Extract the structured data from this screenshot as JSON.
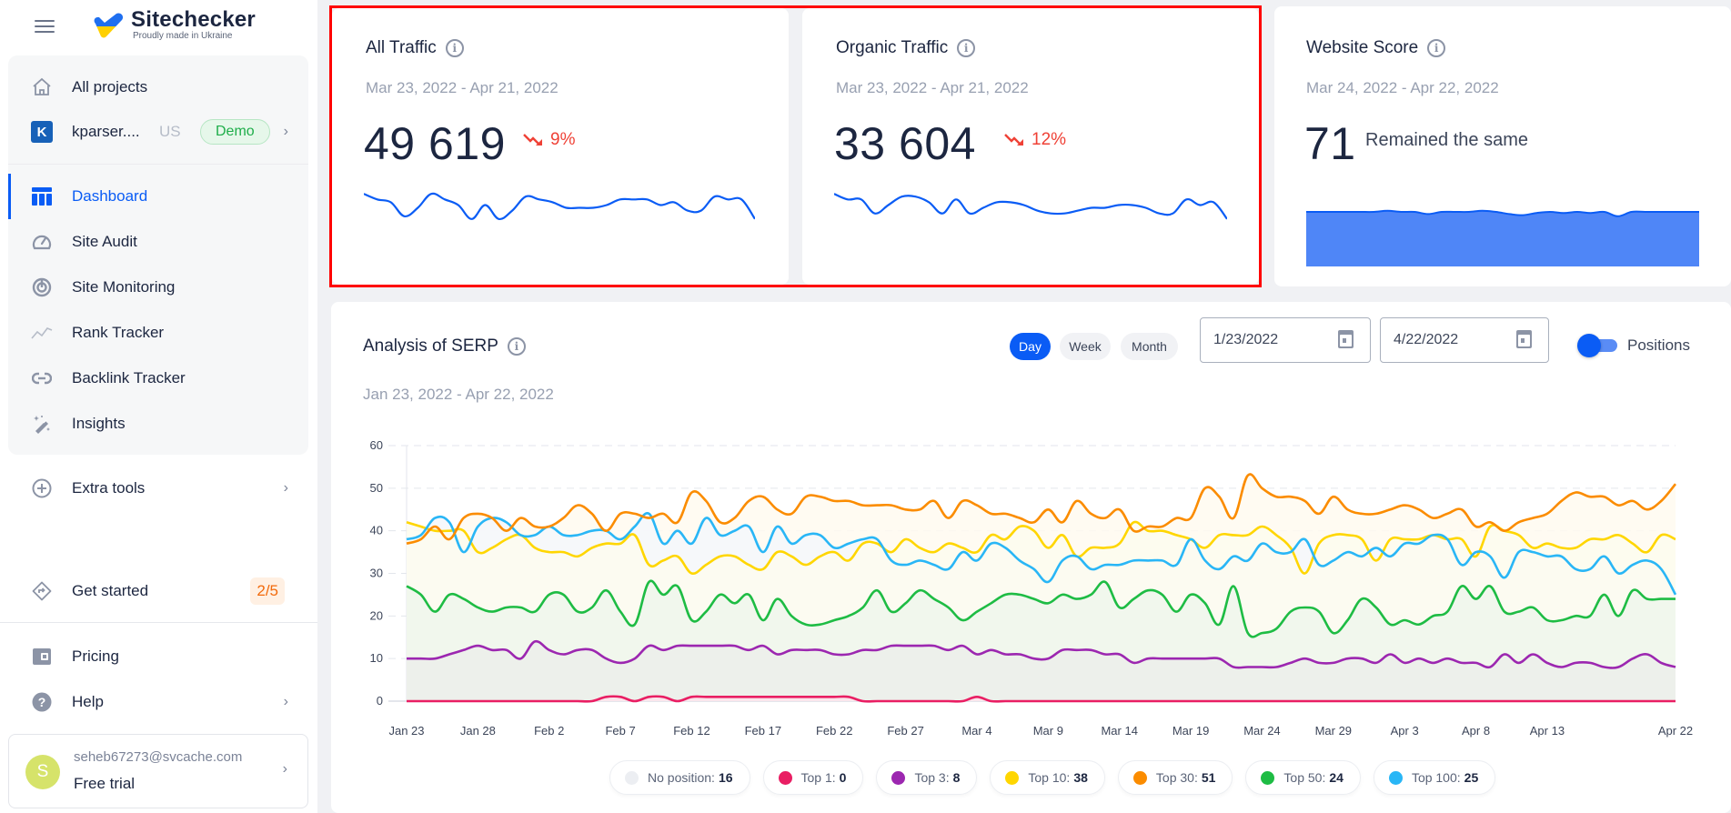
{
  "app": {
    "name": "Sitechecker",
    "tagline": "Proudly made in Ukraine"
  },
  "sidebar": {
    "all_projects": "All projects",
    "project": {
      "initial": "K",
      "name": "kparser....",
      "country": "US",
      "badge": "Demo"
    },
    "nav": [
      {
        "label": "Dashboard",
        "icon": "dashboard-icon",
        "active": true
      },
      {
        "label": "Site Audit",
        "icon": "speedometer-icon",
        "active": false
      },
      {
        "label": "Site Monitoring",
        "icon": "radar-icon",
        "active": false
      },
      {
        "label": "Rank Tracker",
        "icon": "trend-line-icon",
        "active": false
      },
      {
        "label": "Backlink Tracker",
        "icon": "link-icon",
        "active": false
      },
      {
        "label": "Insights",
        "icon": "magic-wand-icon",
        "active": false
      }
    ],
    "extra_tools": "Extra tools",
    "get_started": {
      "label": "Get started",
      "progress": "2/5"
    },
    "pricing": "Pricing",
    "help": "Help",
    "user": {
      "initial": "S",
      "email": "seheb67273@svcache.com",
      "plan": "Free trial"
    }
  },
  "cards": {
    "all_traffic": {
      "title": "All Traffic",
      "date_range": "Mar 23, 2022 - Apr 21, 2022",
      "value": "49 619",
      "delta": "9%",
      "trend": "down",
      "sparkline": [
        55,
        53,
        52,
        47,
        50,
        55,
        53,
        51,
        46,
        51,
        46,
        49,
        54,
        53,
        52,
        50,
        50,
        50,
        51,
        53,
        53,
        53,
        51,
        52,
        49,
        49,
        54,
        53,
        53,
        46
      ]
    },
    "organic_traffic": {
      "title": "Organic Traffic",
      "date_range": "Mar 23, 2022 - Apr 21, 2022",
      "value": "33 604",
      "delta": "12%",
      "trend": "down",
      "sparkline": [
        55,
        53,
        53,
        48,
        51,
        54,
        54,
        52,
        48,
        53,
        48,
        50,
        52,
        52,
        51,
        49,
        48,
        48,
        49,
        50,
        50,
        51,
        51,
        50,
        48,
        48,
        53,
        51,
        52,
        46
      ]
    },
    "website_score": {
      "title": "Website Score",
      "date_range": "Mar 24, 2022 - Apr 22, 2022",
      "value": "71",
      "status": "Remained the same",
      "area": [
        71,
        71,
        71,
        71,
        71,
        71,
        71.2,
        71,
        71,
        70.6,
        71,
        71,
        71,
        71.2,
        71,
        70.6,
        70.4,
        70.8,
        71,
        70.8,
        71,
        70.8,
        71,
        70.2,
        71,
        71,
        71,
        71,
        71,
        71
      ]
    }
  },
  "serp": {
    "title": "Analysis of SERP",
    "date_range": "Jan 23, 2022 - Apr 22, 2022",
    "granularity": [
      "Day",
      "Week",
      "Month"
    ],
    "active_granularity": "Day",
    "date_from": "1/23/2022",
    "date_to": "4/22/2022",
    "toggle_label": "Positions",
    "toggle_on": true
  },
  "chart_data": {
    "type": "area",
    "title": "Analysis of SERP",
    "xlabel": "",
    "ylabel": "",
    "ylim": [
      0,
      60
    ],
    "yticks": [
      0,
      10,
      20,
      30,
      40,
      50,
      60
    ],
    "grid": true,
    "legend_position": "bottom",
    "x_start": "Jan 23",
    "x_count": 90,
    "xtick_labels": [
      {
        "day": 0,
        "label": "Jan 23"
      },
      {
        "day": 5,
        "label": "Jan 28"
      },
      {
        "day": 10,
        "label": "Feb 2"
      },
      {
        "day": 15,
        "label": "Feb 7"
      },
      {
        "day": 20,
        "label": "Feb 12"
      },
      {
        "day": 25,
        "label": "Feb 17"
      },
      {
        "day": 30,
        "label": "Feb 22"
      },
      {
        "day": 35,
        "label": "Feb 27"
      },
      {
        "day": 40,
        "label": "Mar 4"
      },
      {
        "day": 45,
        "label": "Mar 9"
      },
      {
        "day": 50,
        "label": "Mar 14"
      },
      {
        "day": 55,
        "label": "Mar 19"
      },
      {
        "day": 60,
        "label": "Mar 24"
      },
      {
        "day": 65,
        "label": "Mar 29"
      },
      {
        "day": 70,
        "label": "Apr 3"
      },
      {
        "day": 75,
        "label": "Apr 8"
      },
      {
        "day": 80,
        "label": "Apr 13"
      },
      {
        "day": 89,
        "label": "Apr 22"
      }
    ],
    "series": [
      {
        "name": "No position",
        "key": "no_position",
        "color": "#eceef2",
        "current": 16,
        "values": null
      },
      {
        "name": "Top 1",
        "key": "top1",
        "color": "#e91e63",
        "current": 0,
        "values": [
          0,
          0,
          0,
          0,
          0,
          0,
          0,
          0,
          0,
          0,
          0,
          0,
          0,
          0,
          1,
          1,
          0,
          1,
          1,
          0,
          1,
          1,
          1,
          1,
          1,
          1,
          1,
          1,
          1,
          1,
          1,
          1,
          0,
          0,
          0,
          0,
          0,
          0,
          0,
          0,
          1,
          0,
          0,
          0,
          0,
          0,
          0,
          0,
          0,
          0,
          0,
          0,
          0,
          0,
          0,
          0,
          0,
          0,
          0,
          0,
          0,
          0,
          0,
          0,
          0,
          0,
          0,
          0,
          0,
          0,
          0,
          0,
          0,
          0,
          0,
          0,
          0,
          0,
          0,
          0,
          0,
          0,
          0,
          0,
          0,
          0,
          0,
          0,
          0,
          0
        ]
      },
      {
        "name": "Top 3",
        "key": "top3",
        "color": "#9c27b0",
        "current": 8,
        "values": [
          10,
          10,
          10,
          11,
          12,
          13,
          12,
          12,
          10,
          14,
          12,
          11,
          12,
          12,
          10,
          9,
          10,
          13,
          12,
          13,
          13,
          13,
          13,
          13,
          12,
          13,
          11,
          12,
          12,
          12,
          11,
          11,
          12,
          12,
          13,
          13,
          13,
          13,
          12,
          13,
          11,
          12,
          11,
          11,
          10,
          10,
          12,
          12,
          12,
          11,
          11,
          9,
          10,
          10,
          10,
          10,
          10,
          10,
          8,
          8,
          8,
          8,
          9,
          10,
          9,
          9,
          10,
          10,
          9,
          11,
          9,
          10,
          9,
          10,
          9,
          9,
          8,
          11,
          9,
          11,
          9,
          8,
          9,
          9,
          8,
          8,
          10,
          11,
          9,
          8
        ]
      },
      {
        "name": "Top 10",
        "key": "top10",
        "color": "#ffd600",
        "current": 38,
        "values": [
          42,
          41,
          40,
          40,
          40,
          35,
          36,
          38,
          39,
          36,
          35,
          35,
          34,
          36,
          37,
          37,
          39,
          32,
          33,
          34,
          30,
          32,
          34,
          34,
          32,
          31,
          35,
          34,
          32,
          34,
          35,
          33,
          37,
          37,
          35,
          38,
          36,
          35,
          37,
          36,
          35,
          39,
          38,
          41,
          40,
          36,
          39,
          34,
          36,
          36,
          37,
          42,
          40,
          40,
          39,
          38,
          36,
          39,
          39,
          39,
          41,
          39,
          36,
          30,
          37,
          39,
          39,
          38,
          33,
          38,
          38,
          38,
          39,
          38,
          38,
          34,
          41,
          40,
          39,
          36,
          37,
          36,
          36,
          38,
          38,
          39,
          37,
          35,
          39,
          38
        ]
      },
      {
        "name": "Top 30",
        "key": "top30",
        "color": "#fb8c00",
        "current": 51,
        "values": [
          37,
          38,
          41,
          38,
          43,
          44,
          43,
          40,
          43,
          41,
          41,
          43,
          46,
          44,
          40,
          44,
          44,
          43,
          44,
          42,
          49,
          47,
          42,
          43,
          47,
          48,
          45,
          44,
          48,
          48,
          47,
          47,
          46,
          46,
          46,
          45,
          45,
          47,
          43,
          47,
          46,
          44,
          44,
          43,
          42,
          45,
          42,
          47,
          44,
          43,
          45,
          40,
          41,
          41,
          43,
          43,
          50,
          48,
          43,
          53,
          50,
          48,
          48,
          47,
          44,
          48,
          45,
          44,
          44,
          45,
          46,
          45,
          43,
          44,
          45,
          41,
          42,
          40,
          42,
          43,
          44,
          47,
          49,
          48,
          48,
          46,
          47,
          45,
          47,
          51
        ]
      },
      {
        "name": "Top 50",
        "key": "top50",
        "color": "#1ebc44",
        "current": 24,
        "values": [
          27,
          25,
          21,
          25,
          24,
          22,
          21,
          22,
          22,
          21,
          25,
          25,
          21,
          22,
          26,
          21,
          18,
          28,
          25,
          27,
          19,
          21,
          25,
          23,
          25,
          19,
          24,
          20,
          18,
          18,
          19,
          20,
          22,
          26,
          21,
          23,
          26,
          24,
          22,
          19,
          21,
          23,
          25,
          25,
          24,
          23,
          25,
          24,
          25,
          28,
          22,
          24,
          26,
          25,
          21,
          25,
          23,
          18,
          27,
          16,
          16,
          17,
          21,
          22,
          21,
          16,
          19,
          24,
          22,
          18,
          19,
          18,
          20,
          21,
          27,
          24,
          27,
          21,
          21,
          22,
          19,
          19,
          20,
          20,
          25,
          20,
          26,
          24,
          24,
          24
        ]
      },
      {
        "name": "Top 100",
        "key": "top100",
        "color": "#29b6f6",
        "current": 25,
        "values": [
          38,
          39,
          43,
          42,
          35,
          41,
          43,
          42,
          39,
          39,
          41,
          39,
          39,
          40,
          40,
          38,
          41,
          44,
          37,
          40,
          37,
          43,
          39,
          40,
          41,
          35,
          41,
          37,
          39,
          39,
          36,
          37,
          38,
          38,
          33,
          32,
          33,
          32,
          31,
          35,
          33,
          37,
          36,
          33,
          31,
          28,
          33,
          34,
          31,
          32,
          32,
          33,
          33,
          33,
          32,
          38,
          33,
          31,
          34,
          33,
          37,
          35,
          35,
          38,
          32,
          33,
          35,
          34,
          36,
          34,
          37,
          37,
          39,
          38,
          32,
          35,
          34,
          29,
          35,
          35,
          34,
          34,
          31,
          31,
          34,
          30,
          32,
          33,
          31,
          25
        ]
      }
    ]
  }
}
